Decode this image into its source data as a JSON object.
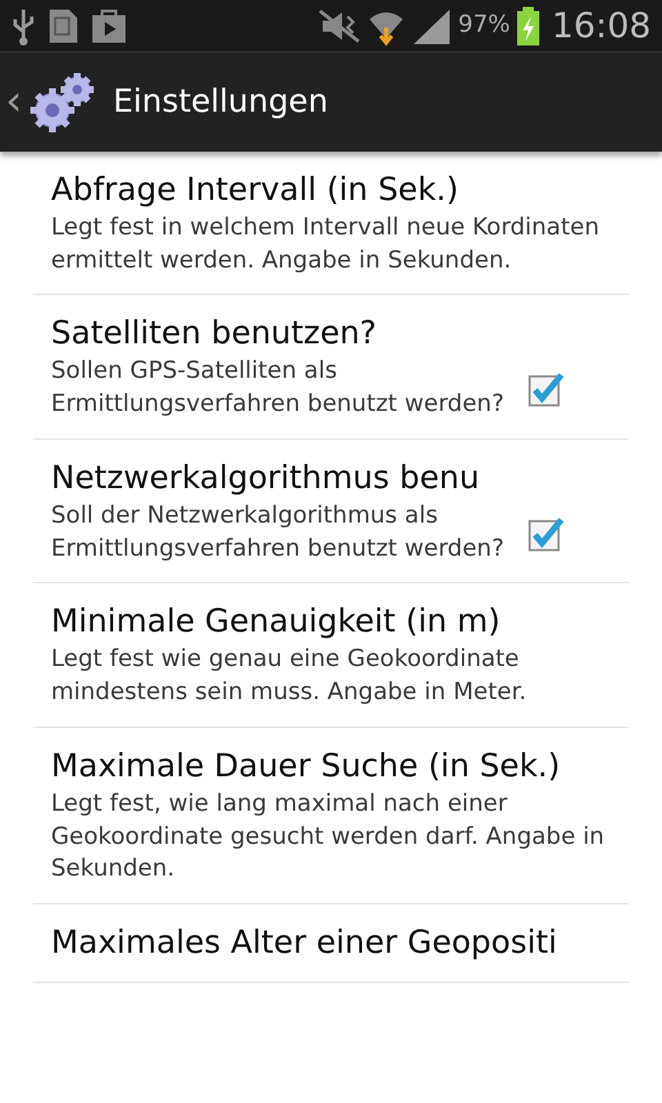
{
  "status_bar": {
    "battery": "97%",
    "time": "16:08"
  },
  "action_bar": {
    "back": "‹",
    "title": "Einstellungen"
  },
  "preferences": [
    {
      "kind": "text",
      "title": "Abfrage Intervall (in Sek.)",
      "summary": "Legt fest in welchem Intervall neue Kordinaten ermittelt werden. Angabe in Sekunden."
    },
    {
      "kind": "checkbox",
      "title": "Satelliten benutzen?",
      "summary": "Sollen GPS-Satelliten als Ermittlungsverfahren benutzt werden?",
      "checked": true
    },
    {
      "kind": "checkbox",
      "title": "Netzwerkalgorithmus benu",
      "summary": "Soll der Netzwerkalgorithmus als Ermittlungsverfahren benutzt werden?",
      "checked": true
    },
    {
      "kind": "text",
      "title": "Minimale Genauigkeit (in m)",
      "summary": "Legt fest wie genau eine Geokoordinate mindestens sein muss. Angabe in Meter."
    },
    {
      "kind": "text",
      "title": "Maximale Dauer Suche (in Sek.)",
      "summary": "Legt fest, wie lang maximal nach einer Geokoordinate gesucht werden darf. Angabe in Sekunden."
    },
    {
      "kind": "text",
      "title": "Maximales Alter einer Geopositi"
    }
  ]
}
